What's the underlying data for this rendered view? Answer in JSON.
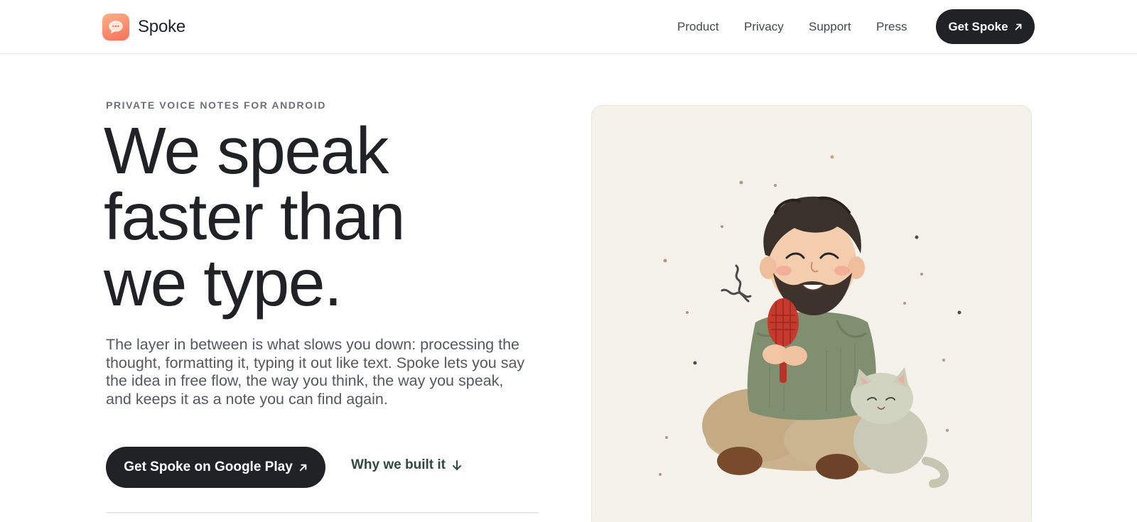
{
  "header": {
    "brand_name": "Spoke",
    "logo_icon": "speech-bubble-icon",
    "nav": [
      {
        "label": "Product"
      },
      {
        "label": "Privacy"
      },
      {
        "label": "Support"
      },
      {
        "label": "Press"
      }
    ],
    "cta_label": "Get Spoke",
    "cta_icon": "arrow-up-right-icon"
  },
  "hero": {
    "eyebrow": "PRIVATE VOICE NOTES FOR ANDROID",
    "headline_lines": [
      "We speak",
      "faster than",
      "we type."
    ],
    "lede": "The layer in between is what slows you down: processing the thought, formatting it, typing it out like text. Spoke lets you say the idea in free flow, the way you think, the way you speak, and keeps it as a note you can find again.",
    "primary_cta": "Get Spoke on Google Play",
    "primary_cta_icon": "arrow-up-right-icon",
    "secondary_cta": "Why we built it",
    "secondary_cta_icon": "arrow-down-icon"
  },
  "illustration": {
    "subject": "illustration of a smiling man holding a red microphone with a cat beside him",
    "background_color": "#f5f2ec"
  },
  "colors": {
    "dark": "#1f2325",
    "accent_green": "#2e4a3f",
    "logo_gradient_start": "#ffb089",
    "logo_gradient_end": "#f4715a",
    "muted_text": "#55595c"
  }
}
